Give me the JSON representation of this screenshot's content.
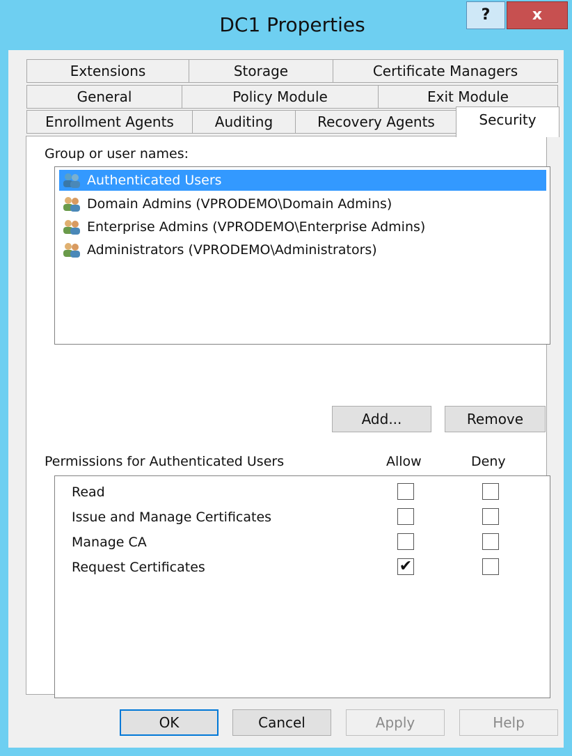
{
  "window": {
    "title": "DC1 Properties",
    "help_label": "?",
    "close_label": "x"
  },
  "tabs_row1": [
    {
      "label": "Extensions"
    },
    {
      "label": "Storage"
    },
    {
      "label": "Certificate Managers"
    }
  ],
  "tabs_row2": [
    {
      "label": "General"
    },
    {
      "label": "Policy Module"
    },
    {
      "label": "Exit Module"
    }
  ],
  "tabs_row3": [
    {
      "label": "Enrollment Agents"
    },
    {
      "label": "Auditing"
    },
    {
      "label": "Recovery Agents"
    },
    {
      "label": "Security",
      "active": true
    }
  ],
  "group_section": {
    "label": "Group or user names:",
    "items": [
      {
        "label": "Authenticated Users",
        "selected": true
      },
      {
        "label": "Domain Admins (VPRODEMO\\Domain Admins)"
      },
      {
        "label": "Enterprise Admins (VPRODEMO\\Enterprise Admins)"
      },
      {
        "label": "Administrators (VPRODEMO\\Administrators)"
      }
    ],
    "add_label": "Add...",
    "remove_label": "Remove"
  },
  "permissions": {
    "header": "Permissions for Authenticated Users",
    "allow_header": "Allow",
    "deny_header": "Deny",
    "rows": [
      {
        "name": "Read",
        "allow": false,
        "deny": false
      },
      {
        "name": "Issue and Manage Certificates",
        "allow": false,
        "deny": false
      },
      {
        "name": "Manage CA",
        "allow": false,
        "deny": false
      },
      {
        "name": "Request Certificates",
        "allow": true,
        "deny": false
      }
    ]
  },
  "footer": {
    "ok_label": "OK",
    "cancel_label": "Cancel",
    "apply_label": "Apply",
    "help_label": "Help"
  },
  "colors": {
    "frame": "#6ecff1",
    "selection": "#3399ff",
    "close_button": "#c75050"
  },
  "icons": {
    "user_group": "users-icon",
    "check": "✔"
  }
}
